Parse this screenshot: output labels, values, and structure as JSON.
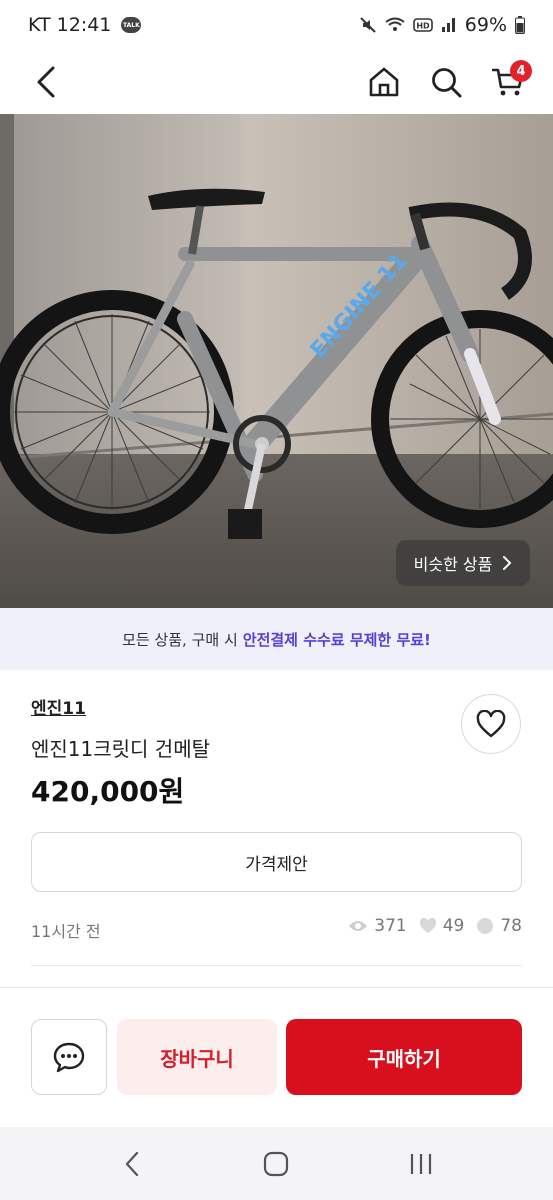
{
  "status": {
    "carrier_time": "KT 12:41",
    "talk_badge": "TALK",
    "battery": "69%"
  },
  "header": {
    "cart_count": "4",
    "icons": [
      "back-arrow-icon",
      "home-icon",
      "search-icon",
      "cart-icon"
    ]
  },
  "photo": {
    "similar_label": "비슷한 상품"
  },
  "promo": {
    "text": "모든 상품, 구매 시",
    "highlight": "안전결제 수수료 무제한 무료!",
    "highlight_color": "#5a3fd6"
  },
  "product": {
    "shop_name": "엔진11",
    "title": "엔진11크릿디 건메탈",
    "price": "420,000원",
    "offer_label": "가격제안",
    "time_ago": "11시간 전",
    "views": "371",
    "likes": "49",
    "chats": "78"
  },
  "actions": {
    "cart_label": "장바구니",
    "buy_label": "구매하기",
    "buy_color": "#d8101e"
  },
  "nav": {
    "icons": [
      "nav-back-icon",
      "nav-home-icon",
      "nav-recents-icon"
    ]
  }
}
